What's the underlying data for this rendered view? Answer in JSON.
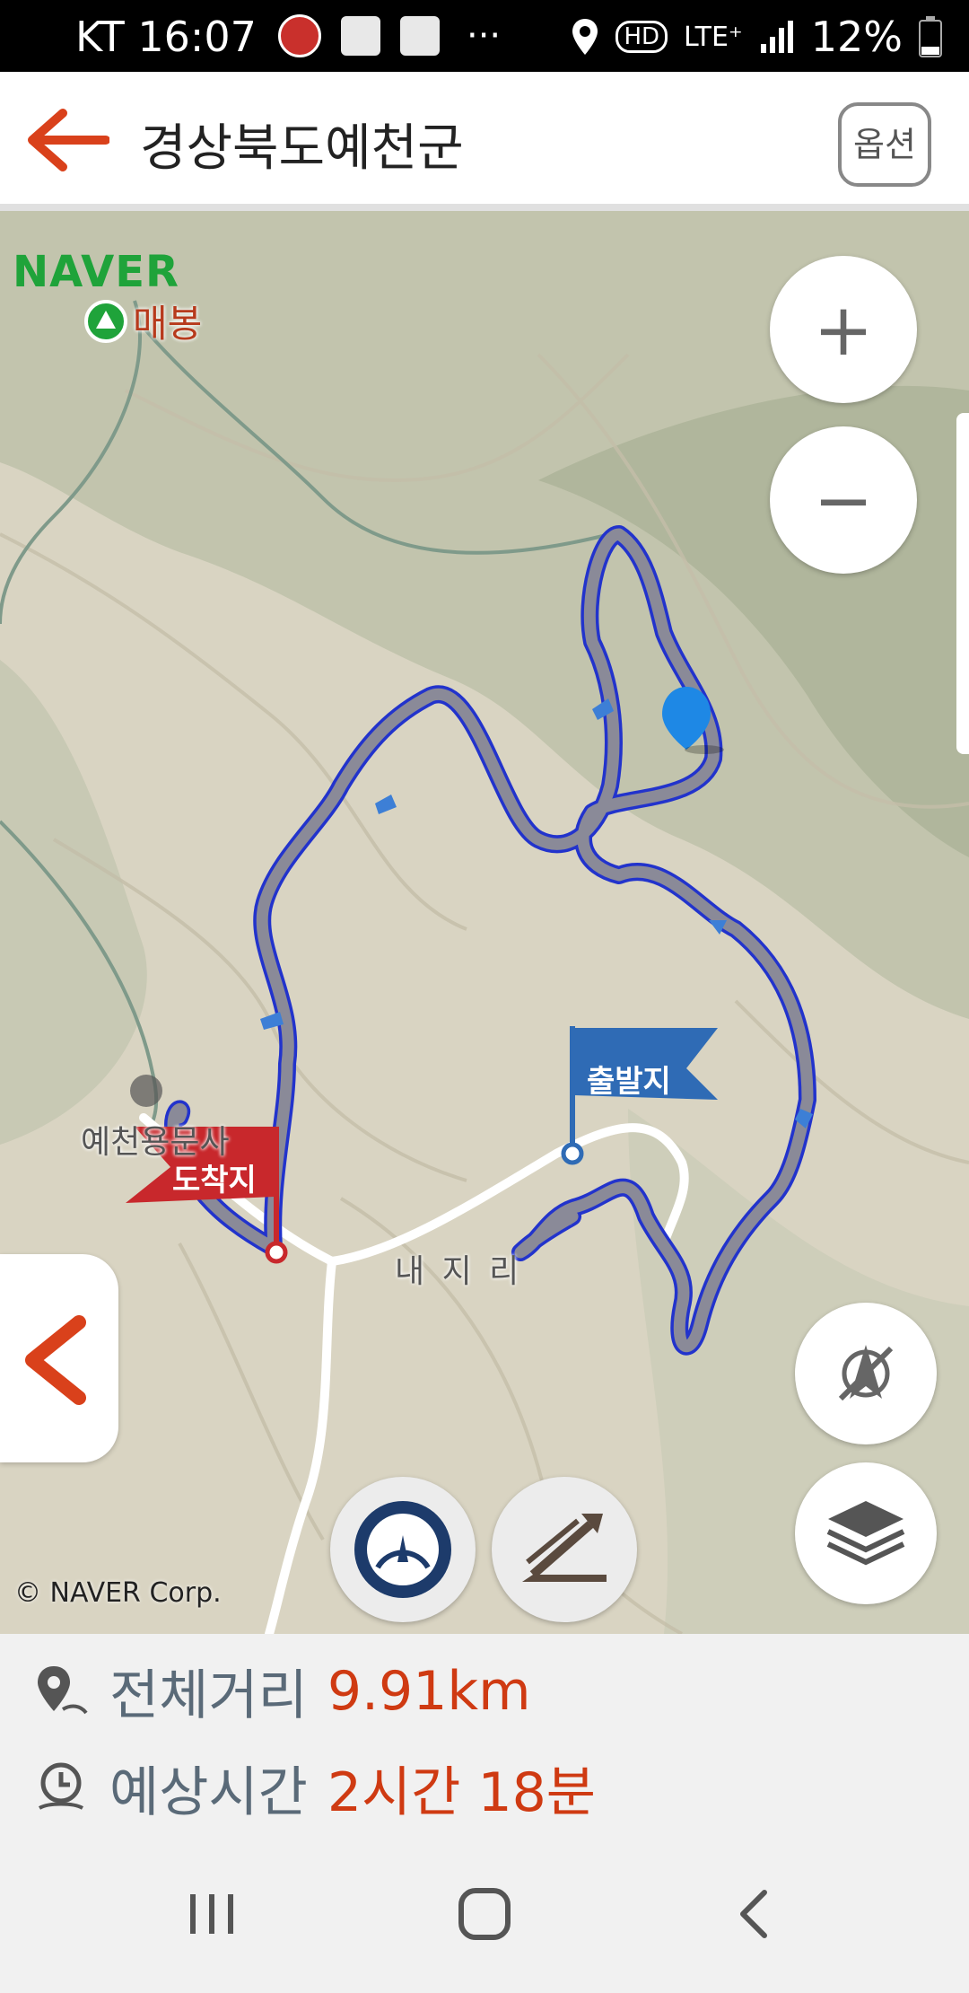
{
  "status_bar": {
    "carrier": "KT 16:07",
    "dots": "···",
    "network": "LTE⁺",
    "battery": "12%"
  },
  "header": {
    "title": "경상북도예천군",
    "option_label": "옵션"
  },
  "map": {
    "logo": "NAVER",
    "peak_label": "매봉",
    "place_label_yecheon": "예천용문사",
    "place_label_naeji": "내 지 리",
    "start_flag": "출발지",
    "end_flag": "도착지",
    "copyright": "© NAVER Corp.",
    "zoom_in": "+",
    "zoom_out": "−"
  },
  "route_info": {
    "distance_label": "전체거리",
    "distance_value": "9.91km",
    "time_label": "예상시간",
    "time_value": "2시간 18분"
  },
  "colors": {
    "accent": "#cf3a12",
    "route_fill": "#8a8a98",
    "route_outline": "#2233cc",
    "start_flag": "#2f6bb5",
    "end_flag": "#c8282c"
  }
}
